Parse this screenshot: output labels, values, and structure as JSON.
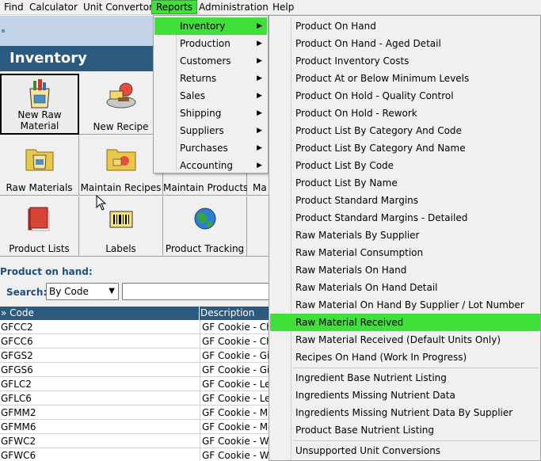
{
  "menubar": {
    "items": [
      "Find",
      "Calculator",
      "Unit Convertor",
      "Reports",
      "Administration",
      "Help"
    ],
    "active": "Reports"
  },
  "header": {
    "title": "Inventory"
  },
  "tiles": {
    "new_raw_material": "New Raw\nMaterial",
    "new_raw_material_l1": "New Raw",
    "new_raw_material_l2": "Material",
    "new_recipe": "New Recipe",
    "raw_materials": "Raw Materials",
    "maintain_recipes": "Maintain Recipes",
    "maintain_products": "Maintain Products",
    "maintain_partial": "Ma",
    "product_lists": "Product Lists",
    "labels": "Labels",
    "product_tracking": "Product Tracking"
  },
  "search": {
    "section_label": "Product on hand:",
    "label": "Search:",
    "mode": "By Code",
    "value": ""
  },
  "table": {
    "columns": [
      "» Code",
      "Description"
    ],
    "rows": [
      [
        "GFCC2",
        "GF Cookie - Ch"
      ],
      [
        "GFCC6",
        "GF Cookie - Ch"
      ],
      [
        "GFGS2",
        "GF Cookie - Gin"
      ],
      [
        "GFGS6",
        "GF Cookie - Gin"
      ],
      [
        "GFLC2",
        "GF Cookie - Le"
      ],
      [
        "GFLC6",
        "GF Cookie - Le"
      ],
      [
        "GFMM2",
        "GF Cookie - M&"
      ],
      [
        "GFMM6",
        "GF Cookie - M&"
      ],
      [
        "GFWC2",
        "GF Cookie - Wh"
      ],
      [
        "GFWC6",
        "GF Cookie - Wh"
      ]
    ]
  },
  "reports_menu": {
    "items": [
      "Inventory",
      "Production",
      "Customers",
      "Returns",
      "Sales",
      "Shipping",
      "Suppliers",
      "Purchases",
      "Accounting"
    ],
    "highlighted": "Inventory"
  },
  "inventory_submenu": {
    "group1": [
      "Product On Hand",
      "Product On Hand - Aged Detail",
      "Product Inventory Costs",
      "Product At or Below Minimum Levels",
      "Product On Hold - Quality Control",
      "Product On Hold - Rework",
      "Product List By Category And Code",
      "Product List By Category And Name",
      "Product List By Code",
      "Product List By Name",
      "Product Standard Margins",
      "Product Standard Margins - Detailed",
      "Raw Materials By Supplier",
      "Raw Material Consumption",
      "Raw Materials On Hand",
      "Raw Materials On Hand Detail",
      "Raw Material On Hand By Supplier / Lot Number",
      "Raw Material Received",
      "Raw Material Received (Default Units Only)",
      "Recipes On Hand (Work In Progress)"
    ],
    "group2": [
      "Ingredient Base Nutrient Listing",
      "Ingredients Missing Nutrient Data",
      "Ingredients Missing Nutrient Data By Supplier",
      "Product Base Nutrient Listing"
    ],
    "group3": [
      "Unsupported Unit Conversions"
    ],
    "highlighted": "Raw Material Received"
  },
  "colors": {
    "highlight": "#3fe03a",
    "header_blue": "#2b5a7e",
    "label_blue": "#1e4f7c"
  }
}
